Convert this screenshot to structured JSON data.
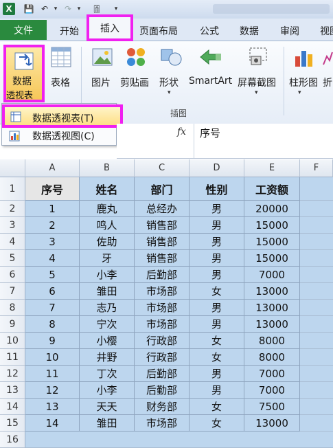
{
  "app": {
    "icon_letter": "X"
  },
  "quick_access": [
    "💾",
    "↶",
    "▾",
    "↷",
    "▾",
    "🎚",
    "▾"
  ],
  "tabs": {
    "file": "文件",
    "home": "开始",
    "insert": "插入",
    "page_layout": "页面布局",
    "formulas": "公式",
    "data": "数据",
    "review": "审阅",
    "view": "视图"
  },
  "ribbon": {
    "pivot_table_line1": "数据",
    "pivot_table_line2": "透视表",
    "table": "表格",
    "picture": "图片",
    "clipart": "剪贴画",
    "shapes": "形状",
    "smartart": "SmartArt",
    "screenshot": "屏幕截图",
    "column_chart": "柱形图",
    "line_chart": "折",
    "group_label": "插图"
  },
  "menu": {
    "items": [
      "数据透视表(T)",
      "数据透视图(C)"
    ]
  },
  "formula_bar": {
    "fx": "fx",
    "value": "序号"
  },
  "sheet": {
    "columns": [
      "A",
      "B",
      "C",
      "D",
      "E",
      "F"
    ],
    "rows": [
      "1",
      "2",
      "3",
      "4",
      "5",
      "6",
      "7",
      "8",
      "9",
      "10",
      "11",
      "12",
      "13",
      "14",
      "15",
      "16"
    ],
    "headers": [
      "序号",
      "姓名",
      "部门",
      "性别",
      "工资额"
    ],
    "data": [
      [
        "1",
        "鹿丸",
        "总经办",
        "男",
        "20000"
      ],
      [
        "2",
        "鸣人",
        "销售部",
        "男",
        "15000"
      ],
      [
        "3",
        "佐助",
        "销售部",
        "男",
        "15000"
      ],
      [
        "4",
        "牙",
        "销售部",
        "男",
        "15000"
      ],
      [
        "5",
        "小李",
        "后勤部",
        "男",
        "7000"
      ],
      [
        "6",
        "雏田",
        "市场部",
        "女",
        "13000"
      ],
      [
        "7",
        "志乃",
        "市场部",
        "男",
        "13000"
      ],
      [
        "8",
        "宁次",
        "市场部",
        "男",
        "13000"
      ],
      [
        "9",
        "小樱",
        "行政部",
        "女",
        "8000"
      ],
      [
        "10",
        "井野",
        "行政部",
        "女",
        "8000"
      ],
      [
        "11",
        "丁次",
        "后勤部",
        "男",
        "7000"
      ],
      [
        "12",
        "小李",
        "后勤部",
        "男",
        "7000"
      ],
      [
        "13",
        "天天",
        "财务部",
        "女",
        "7500"
      ],
      [
        "14",
        "雏田",
        "市场部",
        "女",
        "13000"
      ]
    ]
  },
  "colors": {
    "file_tab": "#2a8a3e",
    "highlight": "#f020f0",
    "cell_fill": "#bdd6ee"
  }
}
